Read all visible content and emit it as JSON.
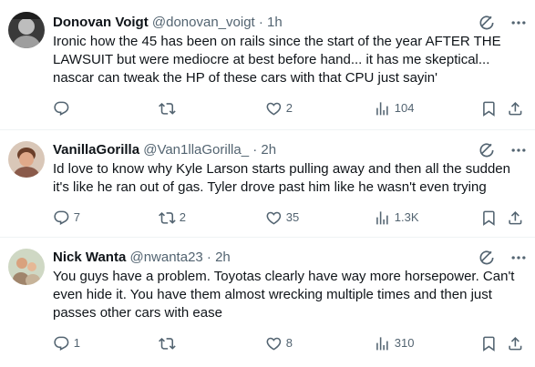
{
  "tweets": [
    {
      "name": "Donovan Voigt",
      "handle": "@donovan_voigt",
      "separator": "·",
      "time": "1h",
      "text": "Ironic how the 45 has been on rails since the start of the year AFTER THE LAWSUIT but were mediocre at best before hand... it has me skeptical... nascar can tweak the HP of these cars with that CPU just sayin'",
      "replies": "",
      "retweets": "",
      "likes": "2",
      "views": "104"
    },
    {
      "name": "VanillaGorilla",
      "handle": "@Van1llaGorilla_",
      "separator": "·",
      "time": "2h",
      "text": "Id love to know why Kyle Larson starts pulling away and then all the sudden it's like he ran out of gas. Tyler drove past him like he wasn't even trying",
      "replies": "7",
      "retweets": "2",
      "likes": "35",
      "views": "1.3K"
    },
    {
      "name": "Nick Wanta",
      "handle": "@nwanta23",
      "separator": "·",
      "time": "2h",
      "text": "You guys have a problem. Toyotas clearly have way more horsepower. Can't even hide it. You have them almost wrecking multiple times and then just passes other cars with ease",
      "replies": "1",
      "retweets": "",
      "likes": "8",
      "views": "310"
    }
  ],
  "icons": {
    "reply": "reply-icon",
    "retweet": "retweet-icon",
    "like": "heart-icon",
    "views": "views-icon",
    "bookmark": "bookmark-icon",
    "share": "share-icon",
    "grok": "grok-icon",
    "more": "more-icon"
  },
  "colors": {
    "text": "#0f1419",
    "secondary": "#536471",
    "divider": "#eff3f4"
  }
}
